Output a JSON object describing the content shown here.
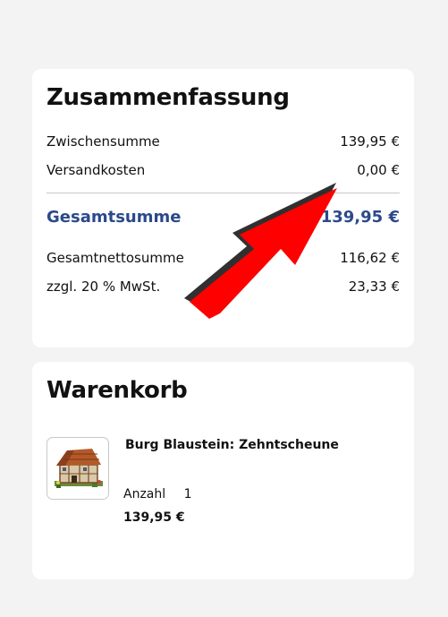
{
  "summary": {
    "title": "Zusammenfassung",
    "subtotal_label": "Zwischensumme",
    "subtotal_value": "139,95 €",
    "shipping_label": "Versandkosten",
    "shipping_value": "0,00 €",
    "total_label": "Gesamtsumme",
    "total_value": "139,95 €",
    "net_label": "Gesamtnettosumme",
    "net_value": "116,62 €",
    "vat_label": "zzgl. 20 % MwSt.",
    "vat_value": "23,33 €"
  },
  "cart": {
    "title": "Warenkorb",
    "items": [
      {
        "name": "Burg Blaustein: Zehntscheune",
        "quantity_label": "Anzahl",
        "quantity": "1",
        "price": "139,95 €",
        "thumbnail_icon": "building-model-icon"
      }
    ]
  },
  "colors": {
    "background": "#f3f3f3",
    "card": "#ffffff",
    "total_accent": "#2b4a8a",
    "annotation_arrow": "#ff0000"
  },
  "annotation": {
    "icon": "red-arrow-icon"
  }
}
